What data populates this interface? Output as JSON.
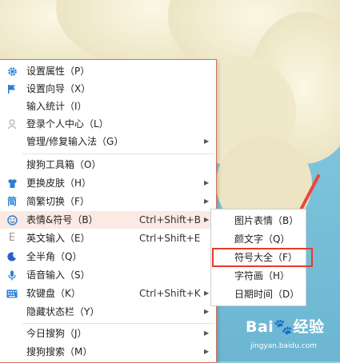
{
  "menu": {
    "items": [
      {
        "icon": "gear-icon",
        "label": "设置属性（P）",
        "shortcut": "",
        "submenu": false
      },
      {
        "icon": "flag-icon",
        "label": "设置向导（X）",
        "shortcut": "",
        "submenu": false
      },
      {
        "icon": "",
        "label": "输入统计（I）",
        "shortcut": "",
        "submenu": false
      },
      {
        "icon": "user-icon",
        "label": "登录个人中心（L）",
        "shortcut": "",
        "submenu": false
      },
      {
        "icon": "",
        "label": "管理/修复输入法（G）",
        "shortcut": "",
        "submenu": true
      },
      {
        "icon": "",
        "label": "搜狗工具箱（O）",
        "shortcut": "",
        "submenu": false
      },
      {
        "icon": "shirt-icon",
        "label": "更换皮肤（H）",
        "shortcut": "",
        "submenu": true
      },
      {
        "icon": "jian-icon",
        "label": "简繁切换（F）",
        "shortcut": "",
        "submenu": true
      },
      {
        "icon": "smiley-icon",
        "label": "表情&符号（B）",
        "shortcut": "Ctrl+Shift+B",
        "submenu": true
      },
      {
        "icon": "english-icon",
        "label": "英文输入（E）",
        "shortcut": "Ctrl+Shift+E",
        "submenu": false
      },
      {
        "icon": "moon-icon",
        "label": "全半角（Q）",
        "shortcut": "",
        "submenu": false
      },
      {
        "icon": "mic-icon",
        "label": "语音输入（S）",
        "shortcut": "",
        "submenu": false
      },
      {
        "icon": "keyboard-icon",
        "label": "软键盘（K）",
        "shortcut": "Ctrl+Shift+K",
        "submenu": true
      },
      {
        "icon": "",
        "label": "隐藏状态栏（Y）",
        "shortcut": "",
        "submenu": true
      },
      {
        "icon": "",
        "label": "今日搜狗（J）",
        "shortcut": "",
        "submenu": true
      },
      {
        "icon": "",
        "label": "搜狗搜索（M）",
        "shortcut": "",
        "submenu": true
      }
    ]
  },
  "submenu": {
    "items": [
      {
        "label": "图片表情（B）"
      },
      {
        "label": "颜文字（Q）"
      },
      {
        "label": "符号大全（F）"
      },
      {
        "label": "字符画（H）"
      },
      {
        "label": "日期时间（D）"
      }
    ]
  },
  "arrow_glyph": "▶",
  "watermark": {
    "logo": "Bai🐾经验",
    "url": "jingyan.baidu.com"
  },
  "colors": {
    "highlight": "#fbe9e3",
    "annotation": "#e53b2e",
    "icon_blue": "#2a7fd4"
  }
}
